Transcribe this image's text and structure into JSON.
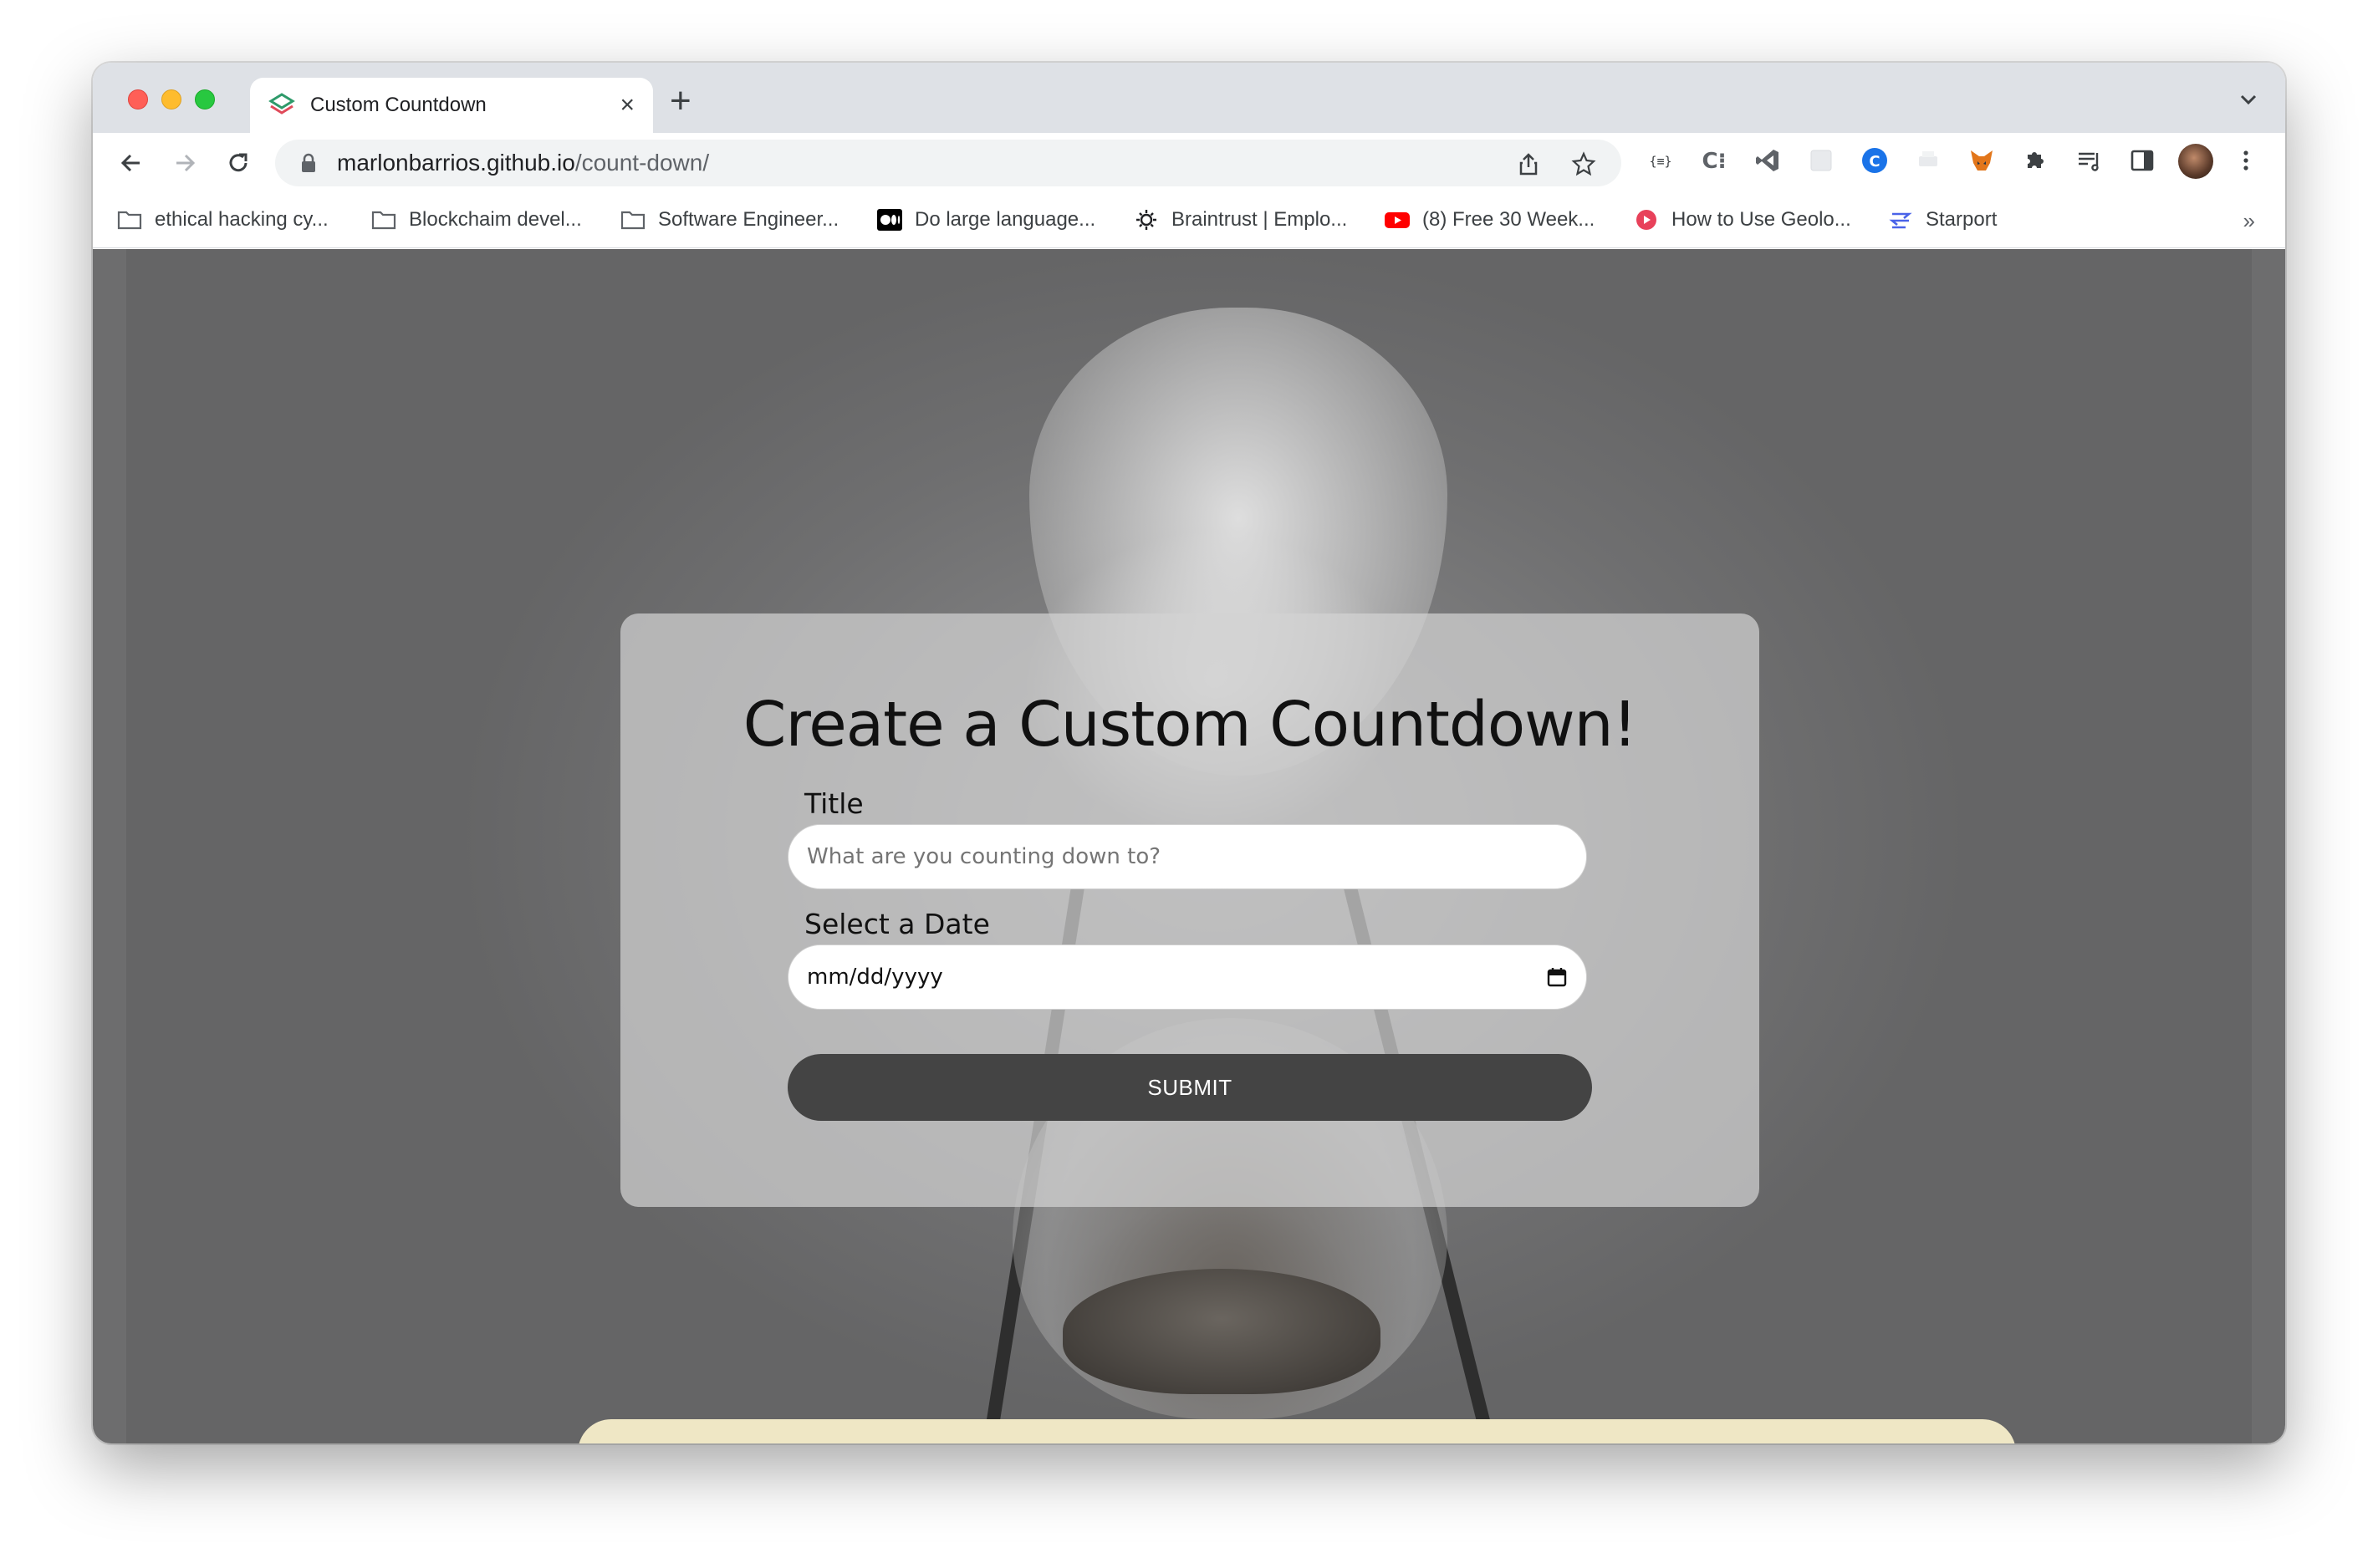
{
  "tab": {
    "title": "Custom Countdown"
  },
  "address": {
    "host": "marlonbarrios.github.io",
    "path": "/count-down/"
  },
  "bookmarks": [
    {
      "label": "ethical hacking cy...",
      "icon": "folder-icon"
    },
    {
      "label": "Blockchaim devel...",
      "icon": "folder-icon"
    },
    {
      "label": "Software Engineer...",
      "icon": "folder-icon"
    },
    {
      "label": "Do large language...",
      "icon": "medium-icon"
    },
    {
      "label": "Braintrust | Emplo...",
      "icon": "braintrust-icon"
    },
    {
      "label": "(8) Free 30 Week...",
      "icon": "youtube-icon"
    },
    {
      "label": "How to Use Geolo...",
      "icon": "play-icon"
    },
    {
      "label": "Starport",
      "icon": "starport-icon"
    }
  ],
  "bookmarks_more": "»",
  "form": {
    "title": "Create a Custom Countdown!",
    "title_label": "Title",
    "title_placeholder": "What are you counting down to?",
    "date_label": "Select a Date",
    "date_placeholder": "mm/dd/yyyy",
    "submit_label": "SUBMIT"
  },
  "colors": {
    "submit_bg": "#444444",
    "tab_strip": "#dee1e6",
    "card_bg": "rgba(210,210,210,0.72)"
  }
}
